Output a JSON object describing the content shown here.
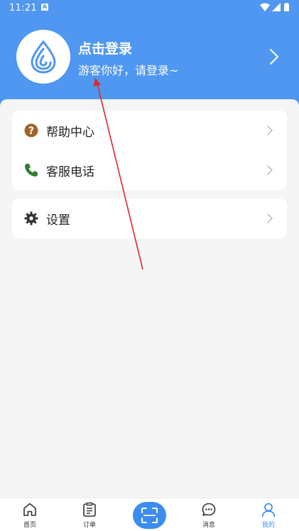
{
  "status_bar": {
    "time": "11:21",
    "badge": "A"
  },
  "profile": {
    "title": "点击登录",
    "subtitle": "游客你好，请登录~"
  },
  "menu": {
    "help": "帮助中心",
    "service": "客服电话",
    "settings": "设置"
  },
  "tabbar": {
    "home": "首页",
    "orders": "订单",
    "messages": "消息",
    "mine": "我的"
  },
  "colors": {
    "header": "#4f97f0",
    "accent": "#3b8cf0",
    "help_icon": "#a0652a",
    "phone_icon": "#2e7d32"
  }
}
